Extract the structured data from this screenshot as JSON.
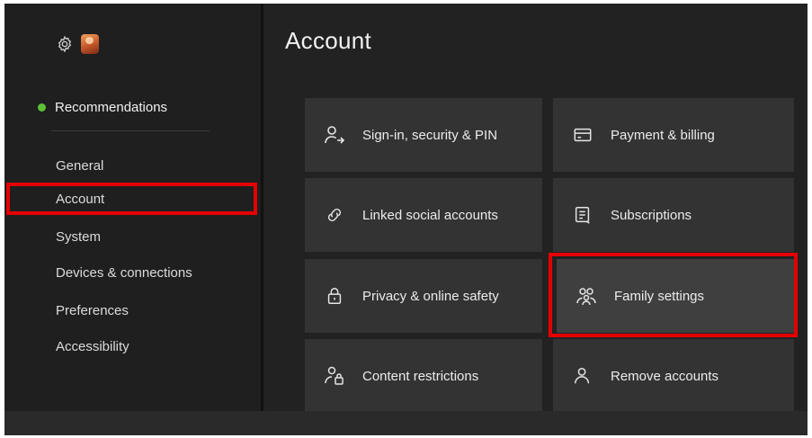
{
  "page": {
    "title": "Account"
  },
  "sidebar": {
    "recommendations": "Recommendations",
    "items": [
      {
        "label": "General"
      },
      {
        "label": "Account"
      },
      {
        "label": "System"
      },
      {
        "label": "Devices & connections"
      },
      {
        "label": "Preferences"
      },
      {
        "label": "Accessibility"
      }
    ],
    "selected": "Account",
    "status_color": "#5bc236"
  },
  "tiles": [
    {
      "label": "Sign-in, security & PIN",
      "icon": "person-arrow-icon"
    },
    {
      "label": "Payment & billing",
      "icon": "credit-card-icon"
    },
    {
      "label": "Linked social accounts",
      "icon": "link-icon"
    },
    {
      "label": "Subscriptions",
      "icon": "document-icon"
    },
    {
      "label": "Privacy & online safety",
      "icon": "lock-icon"
    },
    {
      "label": "Family settings",
      "icon": "family-icon"
    },
    {
      "label": "Content restrictions",
      "icon": "person-lock-icon"
    },
    {
      "label": "Remove accounts",
      "icon": "person-icon"
    }
  ],
  "highlight_color": "#e40000"
}
